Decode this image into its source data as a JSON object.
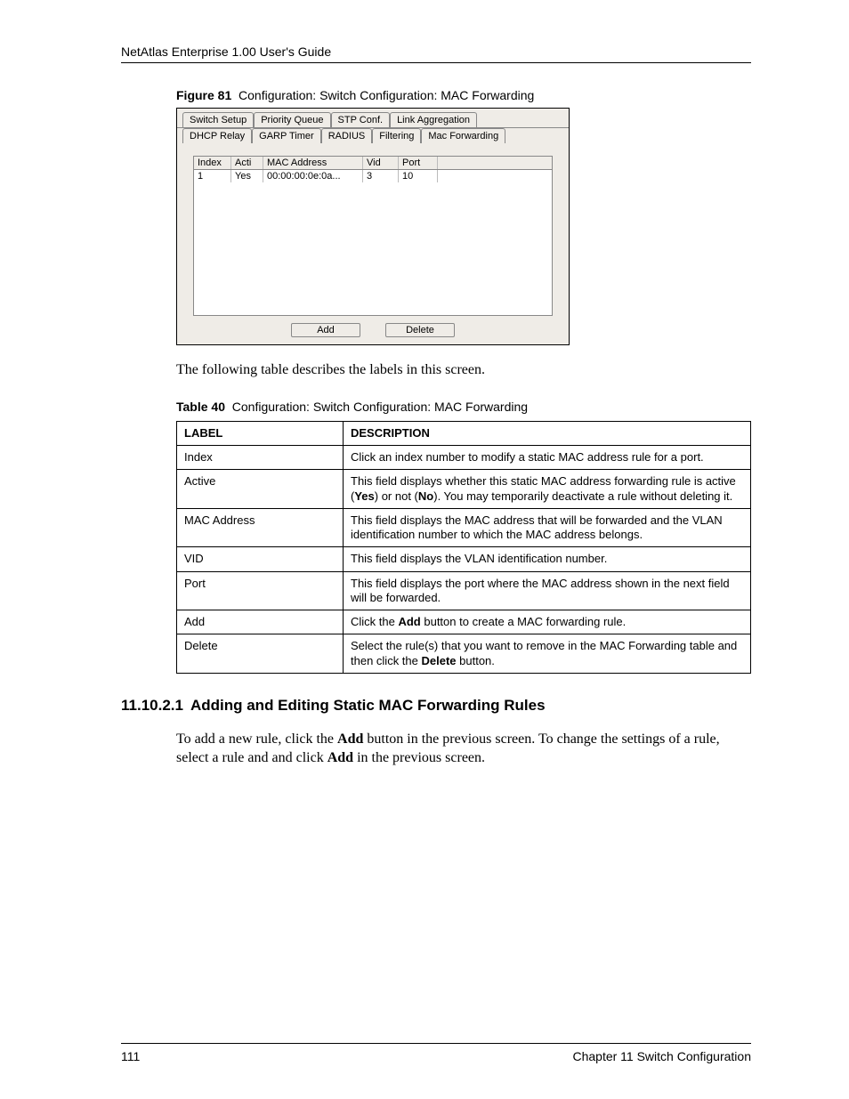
{
  "header": {
    "running": "NetAtlas Enterprise 1.00 User's Guide"
  },
  "figure": {
    "caption_label": "Figure 81",
    "caption_text": "Configuration: Switch Configuration: MAC Forwarding",
    "tabs_row1": [
      "Switch Setup",
      "Priority Queue",
      "STP Conf.",
      "Link Aggregation"
    ],
    "tabs_row2": [
      "DHCP Relay",
      "GARP Timer",
      "RADIUS",
      "Filtering",
      "Mac Forwarding"
    ],
    "active_tab": "Mac Forwarding",
    "list": {
      "headers": {
        "index": "Index",
        "acti": "Acti",
        "mac": "MAC Address",
        "vid": "Vid",
        "port": "Port"
      },
      "rows": [
        {
          "index": "1",
          "acti": "Yes",
          "mac": "00:00:00:0e:0a...",
          "vid": "3",
          "port": "10"
        }
      ]
    },
    "buttons": {
      "add": "Add",
      "delete": "Delete"
    }
  },
  "para_intro": "The following table describes the labels in this screen.",
  "table": {
    "caption_label": "Table 40",
    "caption_text": "Configuration: Switch Configuration: MAC Forwarding",
    "head": {
      "label": "LABEL",
      "desc": "DESCRIPTION"
    },
    "rows": [
      {
        "label": "Index",
        "desc_html": "Click an index number to modify a static MAC address rule for a port."
      },
      {
        "label": "Active",
        "desc_html": "This field displays whether this static MAC address forwarding rule is active (<b>Yes</b>) or not (<b>No</b>). You may temporarily deactivate a rule without deleting it."
      },
      {
        "label": "MAC Address",
        "desc_html": "This field displays the MAC address that will be forwarded and the VLAN identification number to which the MAC address belongs."
      },
      {
        "label": "VID",
        "desc_html": "This field displays the VLAN identification number."
      },
      {
        "label": "Port",
        "desc_html": "This field displays the port where the MAC address shown in the next field will be forwarded."
      },
      {
        "label": "Add",
        "desc_html": "Click the <b>Add</b> button to create a MAC forwarding rule."
      },
      {
        "label": "Delete",
        "desc_html": "Select the rule(s) that you want to remove in the MAC Forwarding table and then click the <b>Delete</b> button."
      }
    ]
  },
  "heading": {
    "num": "11.10.2.1",
    "text": "Adding and Editing Static MAC Forwarding Rules"
  },
  "para_body_html": "To add a new rule, click the <b>Add</b> button in the previous screen. To change the settings of a rule, select a rule and and click <b>Add</b> in the previous screen.",
  "footer": {
    "page": "111",
    "chapter": "Chapter 11 Switch Configuration"
  }
}
